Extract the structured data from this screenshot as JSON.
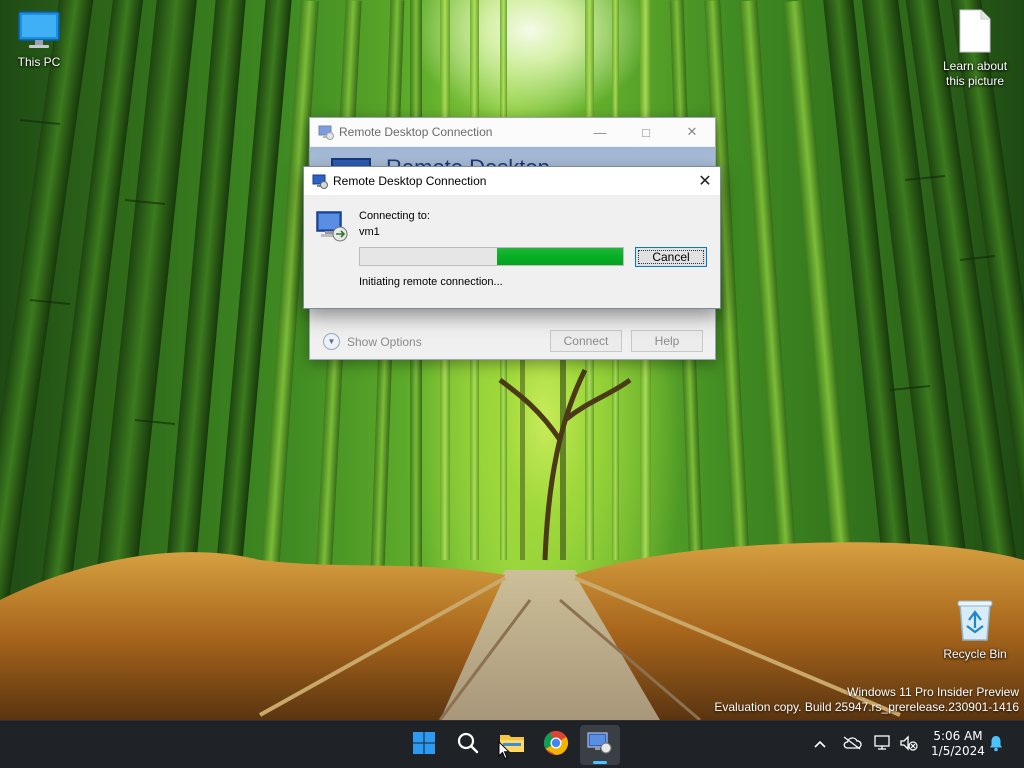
{
  "desktop": {
    "icons": [
      {
        "label": "This PC"
      },
      {
        "label": "Learn about this picture"
      },
      {
        "label": "Recycle Bin"
      }
    ],
    "watermark": {
      "line1": "Windows 11 Pro Insider Preview",
      "line2": "Evaluation copy. Build 25947.rs_prerelease.230901-1416"
    }
  },
  "background_window": {
    "title": "Remote Desktop Connection",
    "banner_text": "Remote Desktop",
    "show_options_label": "Show Options",
    "connect_label": "Connect",
    "help_label": "Help"
  },
  "dialog": {
    "title": "Remote Desktop Connection",
    "connecting_to_label": "Connecting to:",
    "host": "vm1",
    "status_text": "Initiating remote connection...",
    "cancel_label": "Cancel",
    "progress": {
      "segment_start": 0.52,
      "segment_end": 1.0
    }
  },
  "taskbar": {
    "apps": [
      {
        "name": "start",
        "icon": "windows-logo-icon"
      },
      {
        "name": "search",
        "icon": "search-icon"
      },
      {
        "name": "file-explorer",
        "icon": "folder-icon"
      },
      {
        "name": "chrome",
        "icon": "chrome-icon"
      },
      {
        "name": "remote-desktop",
        "icon": "remote-desktop-icon",
        "active": true
      }
    ],
    "tray": {
      "time": "5:06 AM",
      "date": "1/5/2024"
    }
  },
  "colors": {
    "progress_green": "#06b025",
    "taskbar_bg": "#1f2327",
    "accent": "#0078d7",
    "active_indicator": "#4cc2ff"
  }
}
